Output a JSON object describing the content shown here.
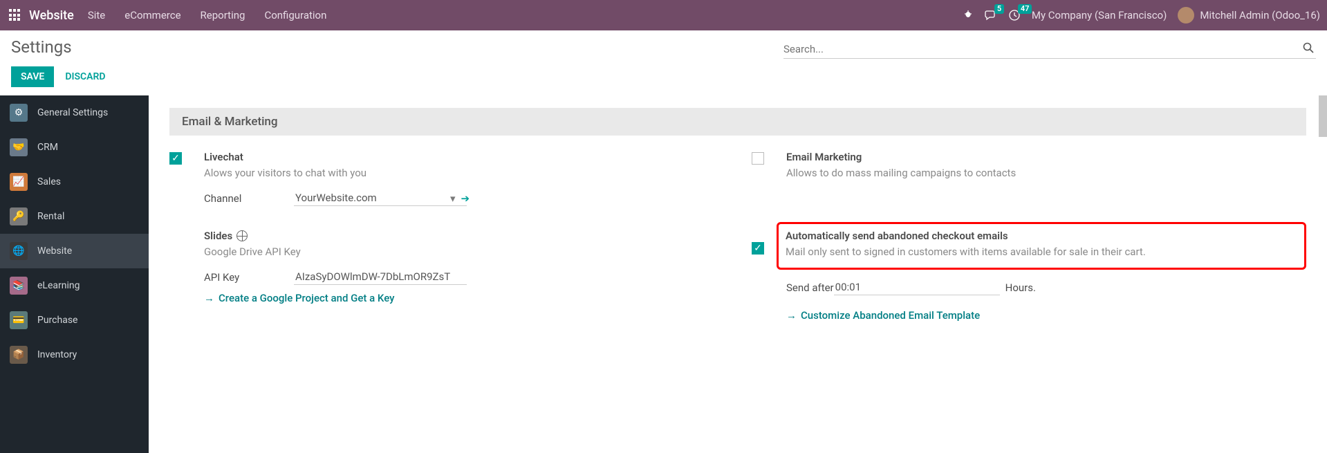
{
  "nav": {
    "brand": "Website",
    "menu": [
      "Site",
      "eCommerce",
      "Reporting",
      "Configuration"
    ],
    "chat_badge": "5",
    "clock_badge": "47",
    "company": "My Company (San Francisco)",
    "user": "Mitchell Admin (Odoo_16)"
  },
  "control": {
    "title": "Settings",
    "save_label": "SAVE",
    "discard_label": "DISCARD",
    "search_placeholder": "Search..."
  },
  "sidebar": {
    "items": [
      {
        "label": "General Settings"
      },
      {
        "label": "CRM"
      },
      {
        "label": "Sales"
      },
      {
        "label": "Rental"
      },
      {
        "label": "Website"
      },
      {
        "label": "eLearning"
      },
      {
        "label": "Purchase"
      },
      {
        "label": "Inventory"
      }
    ]
  },
  "section": {
    "heading": "Email & Marketing",
    "livechat": {
      "title": "Livechat",
      "desc": "Alows your visitors to chat with you",
      "channel_label": "Channel",
      "channel_value": "YourWebsite.com"
    },
    "slides": {
      "title": "Slides",
      "desc": "Google Drive API Key",
      "apikey_label": "API Key",
      "apikey_value": "AIzaSyDOWlmDW-7DbLmOR9ZsT",
      "create_link": "Create a Google Project and Get a Key"
    },
    "email_marketing": {
      "title": "Email Marketing",
      "desc": "Allows to do mass mailing campaigns to contacts"
    },
    "abandoned": {
      "title": "Automatically send abandoned checkout emails",
      "desc": "Mail only sent to signed in customers with items available for sale in their cart.",
      "send_after_label": "Send after",
      "send_after_value": "00:01",
      "hours_label": "Hours.",
      "customize_link": "Customize Abandoned Email Template"
    }
  }
}
